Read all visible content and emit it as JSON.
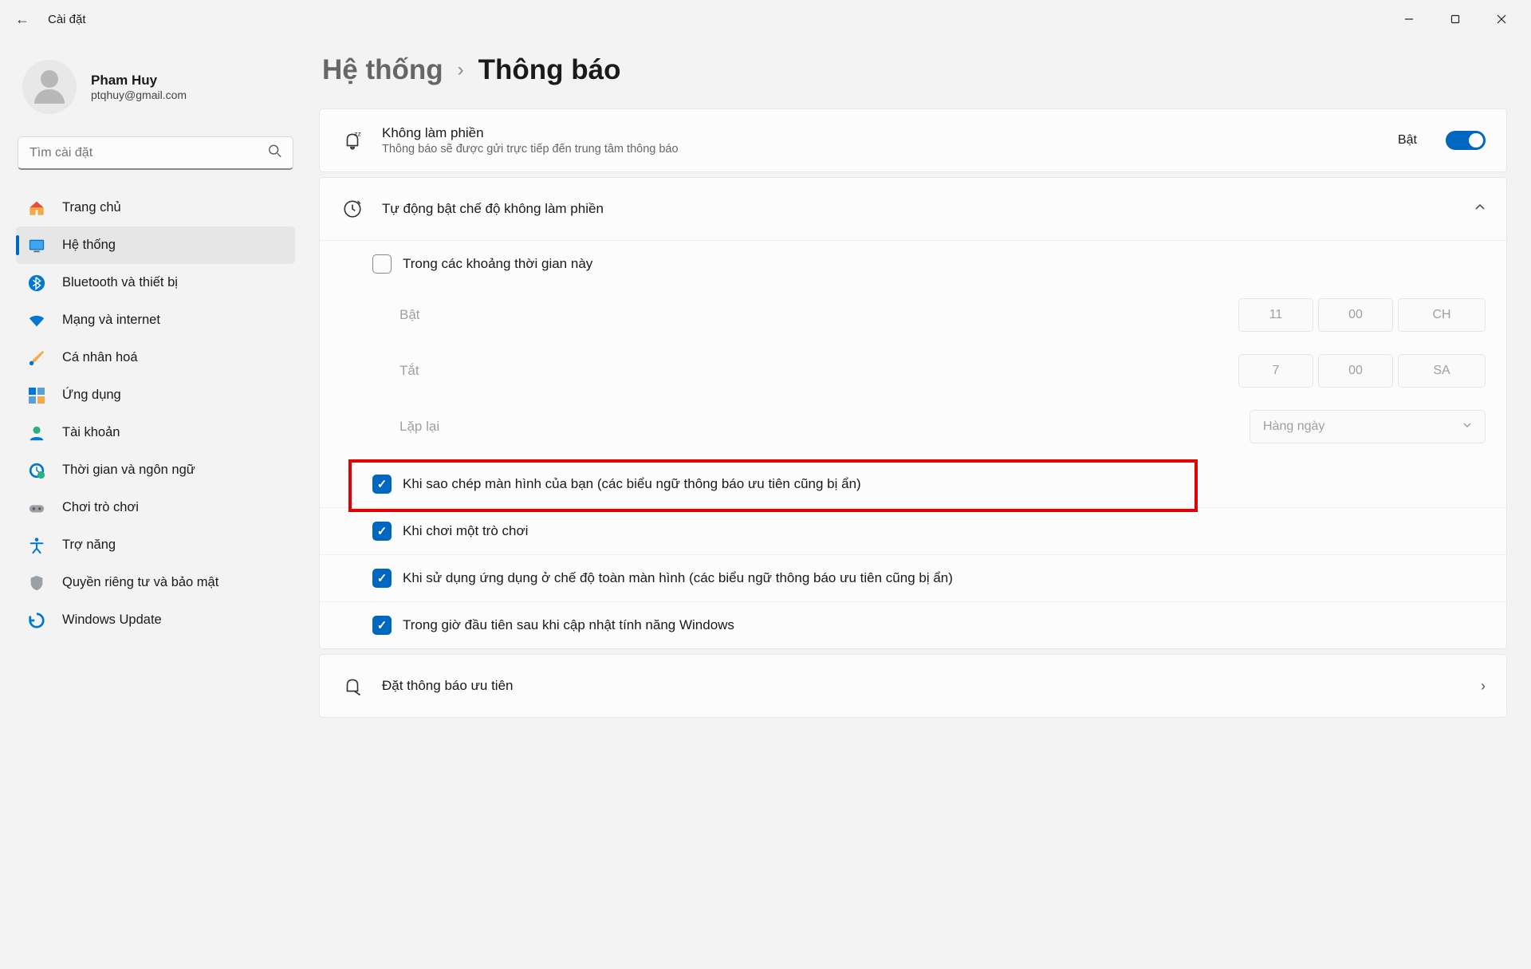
{
  "titlebar": {
    "back_icon": "←",
    "title": "Cài đặt"
  },
  "profile": {
    "name": "Pham Huy",
    "email": "ptqhuy@gmail.com"
  },
  "search": {
    "placeholder": "Tìm cài đặt"
  },
  "nav": {
    "home": "Trang chủ",
    "system": "Hệ thống",
    "bluetooth": "Bluetooth và thiết bị",
    "network": "Mạng và internet",
    "personalize": "Cá nhân hoá",
    "apps": "Ứng dụng",
    "accounts": "Tài khoản",
    "time": "Thời gian và ngôn ngữ",
    "gaming": "Chơi trò chơi",
    "accessibility": "Trợ năng",
    "privacy": "Quyền riêng tư và bảo mật",
    "update": "Windows Update"
  },
  "breadcrumb": {
    "parent": "Hệ thống",
    "current": "Thông báo"
  },
  "dnd": {
    "title": "Không làm phiền",
    "sub": "Thông báo sẽ được gửi trực tiếp đến trung tâm thông báo",
    "state": "Bật"
  },
  "auto": {
    "title": "Tự động bật chế độ không làm phiền",
    "times_label": "Trong các khoảng thời gian này",
    "on_label": "Bật",
    "on_h": "11",
    "on_m": "00",
    "on_ap": "CH",
    "off_label": "Tắt",
    "off_h": "7",
    "off_m": "00",
    "off_ap": "SA",
    "repeat_label": "Lặp lại",
    "repeat_value": "Hàng ngày",
    "opt_screen": "Khi sao chép màn hình của bạn (các biểu ngữ thông báo ưu tiên cũng bị ẩn)",
    "opt_game": "Khi chơi một trò chơi",
    "opt_fullscreen": "Khi sử dụng ứng dụng ở chế độ toàn màn hình (các biểu ngữ thông báo ưu tiên cũng bị ẩn)",
    "opt_update": "Trong giờ đầu tiên sau khi cập nhật tính năng Windows"
  },
  "priority": {
    "title": "Đặt thông báo ưu tiên"
  }
}
